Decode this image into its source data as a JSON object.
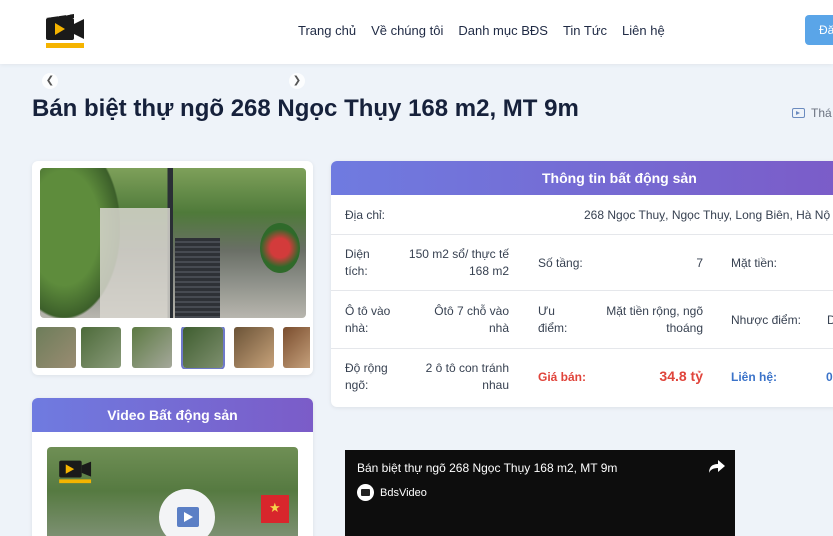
{
  "header": {
    "nav": [
      "Trang chủ",
      "Về chúng tôi",
      "Danh mục BĐS",
      "Tin Tức",
      "Liên hệ"
    ],
    "cta_label": "Đă",
    "logo_alt_text": "BDSVIDEO.VN"
  },
  "page": {
    "title": "Bán biệt thự ngõ 268 Ngọc Thụy 168 m2, MT 9m",
    "side_link": "Thá"
  },
  "gallery": {
    "prev_icon": "chevron-left-icon",
    "next_icon": "chevron-right-icon",
    "thumbnail_count": 6,
    "active_thumbnail": 4
  },
  "video_section": {
    "heading": "Video Bất động sản",
    "play_icon": "play-icon"
  },
  "info": {
    "heading": "Thông tin bất động sản",
    "address_label": "Địa chỉ:",
    "address_value": "268 Ngọc Thuỵ, Ngọc Thụy, Long Biên, Hà Nộ",
    "area_label_1": "Diện",
    "area_label_2": "tích:",
    "area_value_1": "150 m2 sổ/ thực tế",
    "area_value_2": "168 m2",
    "floors_label": "Số tầng:",
    "floors_value": "7",
    "frontage_label": "Mặt tiền:",
    "car_label_1": "Ô tô vào",
    "car_label_2": "nhà:",
    "car_value_1": "Ôtô 7 chỗ vào",
    "car_value_2": "nhà",
    "pros_label_1": "Ưu",
    "pros_label_2": "điểm:",
    "pros_value_1": "Mặt tiền rộng, ngõ",
    "pros_value_2": "thoáng",
    "cons_label": "Nhược điểm:",
    "cons_value": "D",
    "lane_label_1": "Độ rộng",
    "lane_label_2": "ngõ:",
    "lane_value_1": "2 ô tô con tránh",
    "lane_value_2": "nhau",
    "price_label": "Giá bán:",
    "price_value": "34.8 tỷ",
    "contact_label": "Liên hệ:",
    "contact_value": "0"
  },
  "youtube": {
    "title": "Bán biệt thự ngõ 268 Ngọc Thụy 168 m2, MT 9m",
    "channel": "BdsVideo",
    "share_icon": "share-arrow-icon"
  },
  "colors": {
    "accent_gradient_start": "#6f7be0",
    "accent_gradient_end": "#7b5cc8",
    "price_red": "#e0443b",
    "contact_blue": "#3b73c9",
    "cta_blue": "#5aa5e8"
  }
}
